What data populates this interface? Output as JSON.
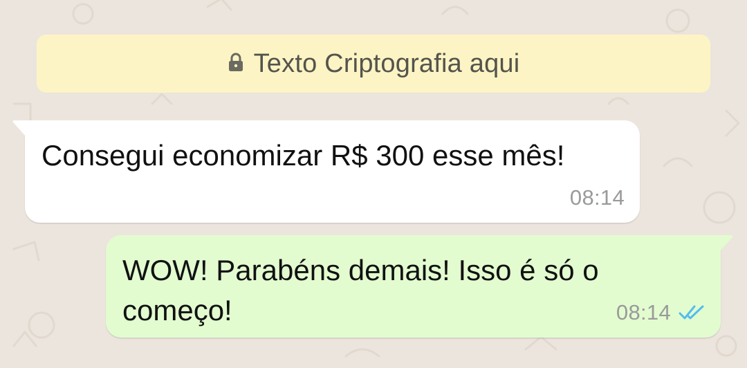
{
  "encryption_notice": {
    "icon": "lock-icon",
    "text": "Texto Criptografia aqui"
  },
  "messages": [
    {
      "direction": "incoming",
      "text": "Consegui economizar R$ 300 esse mês!",
      "time": "08:14"
    },
    {
      "direction": "outgoing",
      "text": "WOW! Parabéns demais! Isso é só o começo!",
      "time": "08:14",
      "status_icon": "double-check-icon"
    }
  ],
  "colors": {
    "wallpaper": "#ECE5DD",
    "notice_background": "#FCF4C4",
    "incoming_bubble": "#FFFFFF",
    "outgoing_bubble": "#E2FCD0",
    "read_check": "#53BDEB"
  }
}
